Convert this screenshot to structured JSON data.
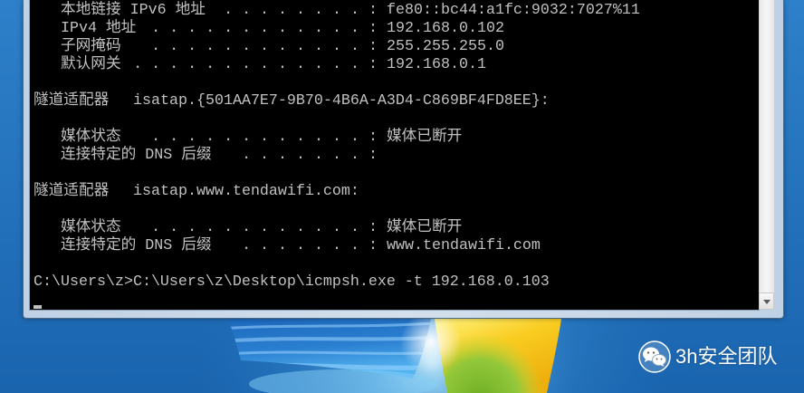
{
  "colors": {
    "console_background": "#000000",
    "console_text": "#c0c0c0",
    "window_frame": "#c8d7e8",
    "desktop_blue": "#1f6cb4",
    "watermark_text": "#ffffff"
  },
  "icons": {
    "scroll_down": "scroll-down-arrow-icon",
    "watermark": "wechat-icon",
    "desktop_logo": "windows-logo-icon"
  },
  "console": {
    "interface_entries": [
      {
        "label": "本地链接 IPv6 地址",
        "leader": ". . . . . . . . :",
        "value": "fe80::bc44:a1fc:9032:7027%11"
      },
      {
        "label": "IPv4 地址",
        "leader": ". . . . . . . . . . . . :",
        "value": "192.168.0.102"
      },
      {
        "label": "子网掩码",
        "leader": ". . . . . . . . . . . . :",
        "value": "255.255.255.0"
      },
      {
        "label": "默认网关",
        "leader": ". . . . . . . . . . . . . :",
        "value": "192.168.0.1"
      }
    ],
    "adapters": [
      {
        "title": "隧道适配器",
        "name": "isatap.{501AA7E7-9B70-4B6A-A3D4-C869BF4FD8EE}:",
        "entries": [
          {
            "label": "媒体状态",
            "leader": ". . . . . . . . . . . . :",
            "value": "媒体已断开"
          },
          {
            "label": "连接特定的 DNS 后缀",
            "leader": ". . . . . . . :"
          }
        ]
      },
      {
        "title": "隧道适配器",
        "name": "isatap.www.tendawifi.com:",
        "entries": [
          {
            "label": "媒体状态",
            "leader": ". . . . . . . . . . . . :",
            "value": "媒体已断开"
          },
          {
            "label": "连接特定的 DNS 后缀",
            "leader": ". . . . . . . :",
            "value": "www.tendawifi.com"
          }
        ]
      }
    ],
    "prompt_line": "C:\\Users\\z>C:\\Users\\z\\Desktop\\icmpsh.exe -t 192.168.0.103"
  },
  "watermark": {
    "text": "3h安全团队"
  }
}
